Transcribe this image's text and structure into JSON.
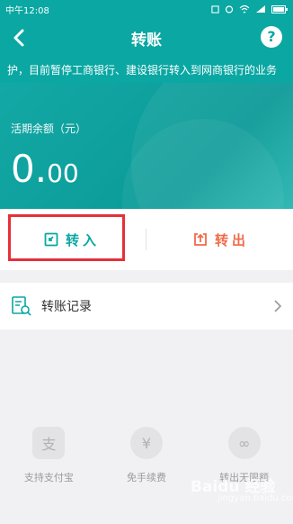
{
  "status_bar": {
    "carrier_time": "中午12:08"
  },
  "header": {
    "title": "转账",
    "help_label": "?"
  },
  "notice": {
    "text": "护，目前暂停工商银行、建设银行转入到网商银行的业务"
  },
  "balance": {
    "label": "活期余额（元）",
    "amount_int": "0.",
    "amount_dec": "00"
  },
  "actions": {
    "transfer_in": "转入",
    "transfer_out": "转出"
  },
  "records": {
    "label": "转账记录"
  },
  "features": [
    {
      "label": "支持支付宝",
      "icon": "alipay-icon",
      "glyph": "支"
    },
    {
      "label": "免手续费",
      "icon": "yuan-icon",
      "glyph": "¥"
    },
    {
      "label": "转出无限额",
      "icon": "infinity-icon",
      "glyph": "∞"
    }
  ],
  "watermark": {
    "brand": "Baidu 经验",
    "url": "jingyan.baidu.com"
  },
  "colors": {
    "teal": "#0aa7a3",
    "orange": "#ef6b4a",
    "highlight": "#e5303a"
  }
}
